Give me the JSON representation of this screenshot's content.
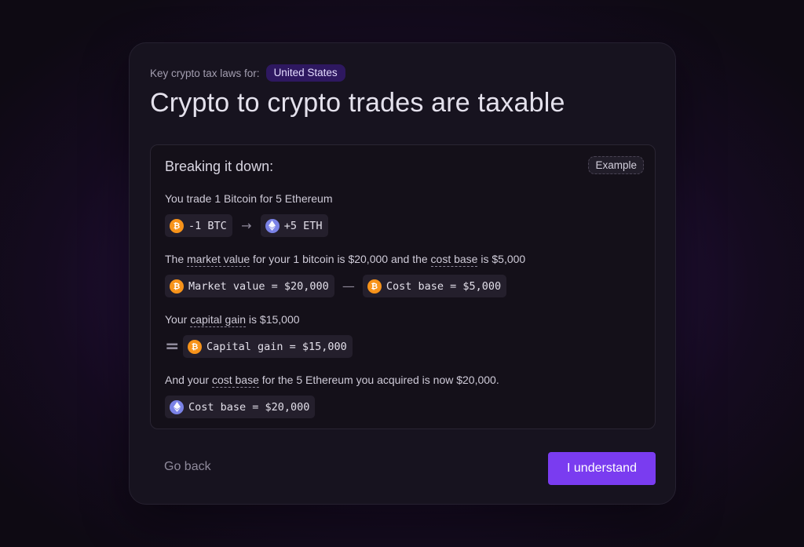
{
  "header": {
    "kicker": "Key crypto tax laws for:",
    "country": "United States",
    "title": "Crypto to crypto trades are taxable"
  },
  "panel": {
    "heading": "Breaking it down:",
    "badge": "Example",
    "step1": {
      "text": "You trade 1 Bitcoin for 5 Ethereum",
      "chip_from": "-1 BTC",
      "chip_to": "+5 ETH",
      "arrow": "→"
    },
    "step2": {
      "t1": "The ",
      "term1": "market value",
      "t2": " for your 1 bitcoin is $20,000 and the ",
      "term2": "cost base",
      "t3": " is $5,000",
      "chip_a": "Market value = $20,000",
      "operator": "—",
      "chip_b": "Cost base = $5,000"
    },
    "step3": {
      "t1": "Your ",
      "term": "capital gain",
      "t2": " is $15,000",
      "equals": "=",
      "chip": "Capital gain = $15,000"
    },
    "step4": {
      "t1": "And your ",
      "term": "cost base",
      "t2": " for the 5 Ethereum you acquired is now $20,000.",
      "chip": "Cost base = $20,000"
    },
    "coin_btc_symbol": "₿"
  },
  "footer": {
    "back_label": "Go back",
    "confirm_label": "I understand"
  },
  "colors": {
    "accent": "#7a3cf0",
    "btc": "#f7931a",
    "eth": "#7a82e6",
    "badge_bg": "#2e1860"
  },
  "icons": {
    "btc": "bitcoin-icon",
    "eth": "ethereum-icon",
    "arrow": "arrow-right-icon"
  }
}
